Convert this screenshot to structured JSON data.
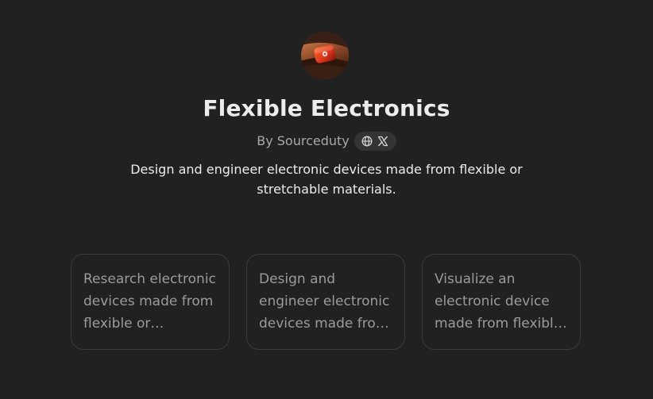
{
  "gpt": {
    "title": "Flexible Electronics",
    "author_label": "By Sourceduty",
    "social_icons": [
      "globe-icon",
      "x-logo-icon"
    ],
    "description": "Design and engineer electronic devices made from flexible or stretchable materials."
  },
  "conversation_starters": [
    {
      "text": "Research electronic devices made from flexible or stretchable materials."
    },
    {
      "text": "Design and engineer electronic devices made from flexible or stretchable materials."
    },
    {
      "text": "Visualize an electronic device made from flexible or stretchable materials."
    }
  ],
  "colors": {
    "background": "#212121",
    "title": "#ececec",
    "muted_text": "#a8a8a8",
    "card_border": "#3b3b3b",
    "card_text": "#9b9b9b",
    "pill_background": "#343434"
  }
}
